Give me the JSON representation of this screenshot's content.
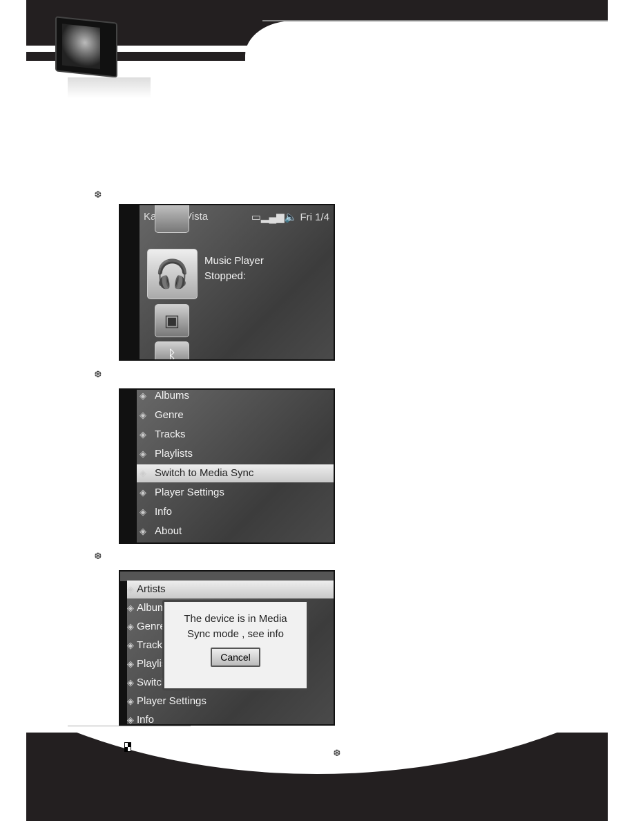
{
  "header": {
    "device_image": "media-player-device"
  },
  "bullet_icon": "snowflake-bullet-icon",
  "screen1": {
    "title": "KaneLu_Vista",
    "status_icons": [
      "battery-icon",
      "signal-icon",
      "volume-icon"
    ],
    "date": "Fri 1/4",
    "app": "Music Player",
    "state": "Stopped:"
  },
  "screen2": {
    "items": [
      {
        "label": "Albums",
        "icon": "albums-icon"
      },
      {
        "label": "Genre",
        "icon": "genre-icon"
      },
      {
        "label": "Tracks",
        "icon": "tracks-icon"
      },
      {
        "label": "Playlists",
        "icon": "playlists-icon"
      },
      {
        "label": "Switch to Media Sync",
        "icon": "sync-icon",
        "selected": true
      },
      {
        "label": "Player Settings",
        "icon": "settings-icon"
      },
      {
        "label": "Info",
        "icon": "info-icon"
      },
      {
        "label": "About",
        "icon": "about-icon"
      }
    ]
  },
  "screen3": {
    "items": [
      {
        "label": "Artists",
        "selected": true
      },
      {
        "label": "Albums"
      },
      {
        "label": "Genre"
      },
      {
        "label": "Tracks"
      },
      {
        "label": "Playlists"
      },
      {
        "label": "Switch"
      },
      {
        "label": "Player Settings"
      },
      {
        "label": "Info"
      }
    ],
    "dialog": {
      "message_line1": "The device is in Media",
      "message_line2": "Sync mode , see info",
      "cancel": "Cancel"
    }
  }
}
